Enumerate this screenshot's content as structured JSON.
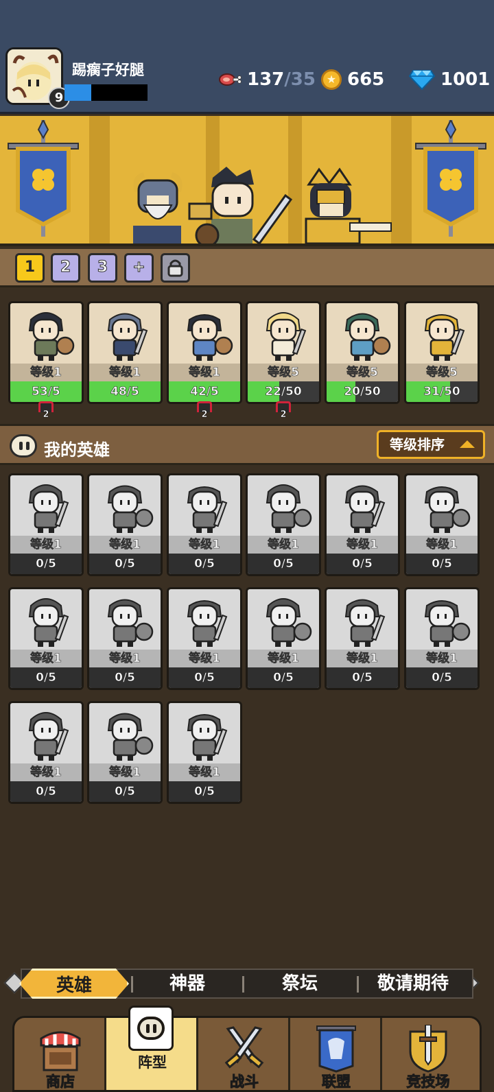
{
  "player": {
    "name": "踢瘸子好腿",
    "level": "9",
    "xp_fraction": 0.32
  },
  "resources": {
    "meat_current": "137",
    "meat_max": "/35",
    "gold": "665",
    "gems": "1001",
    "icons": [
      "meat-icon",
      "gold-coin-icon",
      "diamond-icon"
    ]
  },
  "formation_tabs": [
    "1",
    "2",
    "3",
    "+",
    "lock-icon"
  ],
  "team": [
    {
      "level": "等级1",
      "progress": "53/5",
      "fill": 1.0,
      "tag": "2"
    },
    {
      "level": "等级1",
      "progress": "48/5",
      "fill": 1.0,
      "tag": ""
    },
    {
      "level": "等级1",
      "progress": "42/5",
      "fill": 1.0,
      "tag": "2"
    },
    {
      "level": "等级5",
      "progress": "22/50",
      "fill": 0.44,
      "tag": "2"
    },
    {
      "level": "等级5",
      "progress": "20/50",
      "fill": 0.4,
      "tag": ""
    },
    {
      "level": "等级5",
      "progress": "31/50",
      "fill": 0.62,
      "tag": ""
    }
  ],
  "my_heroes": {
    "title": "我的英雄",
    "sort_label": "等级排序"
  },
  "roster": [
    {
      "level": "等级1",
      "progress": "0/5"
    },
    {
      "level": "等级1",
      "progress": "0/5"
    },
    {
      "level": "等级1",
      "progress": "0/5"
    },
    {
      "level": "等级1",
      "progress": "0/5"
    },
    {
      "level": "等级1",
      "progress": "0/5"
    },
    {
      "level": "等级1",
      "progress": "0/5"
    },
    {
      "level": "等级1",
      "progress": "0/5"
    },
    {
      "level": "等级1",
      "progress": "0/5"
    },
    {
      "level": "等级1",
      "progress": "0/5"
    },
    {
      "level": "等级1",
      "progress": "0/5"
    },
    {
      "level": "等级1",
      "progress": "0/5"
    },
    {
      "level": "等级1",
      "progress": "0/5"
    },
    {
      "level": "等级1",
      "progress": "0/5"
    },
    {
      "level": "等级1",
      "progress": "0/5"
    },
    {
      "level": "等级1",
      "progress": "0/5"
    }
  ],
  "sub_tabs": [
    "英雄",
    "神器",
    "祭坛",
    "敬请期待"
  ],
  "bottom_nav": [
    {
      "label": "商店",
      "icon": "shop-icon"
    },
    {
      "label": "阵型",
      "icon": "formation-icon"
    },
    {
      "label": "战斗",
      "icon": "crossed-swords-icon"
    },
    {
      "label": "联盟",
      "icon": "alliance-banner-icon"
    },
    {
      "label": "竞技场",
      "icon": "arena-shield-icon"
    }
  ],
  "colors": {
    "accent": "#f7c81b",
    "progress_green": "#5bd24a",
    "xp_blue": "#2c8ee6",
    "gem_blue": "#2aa8f0"
  }
}
